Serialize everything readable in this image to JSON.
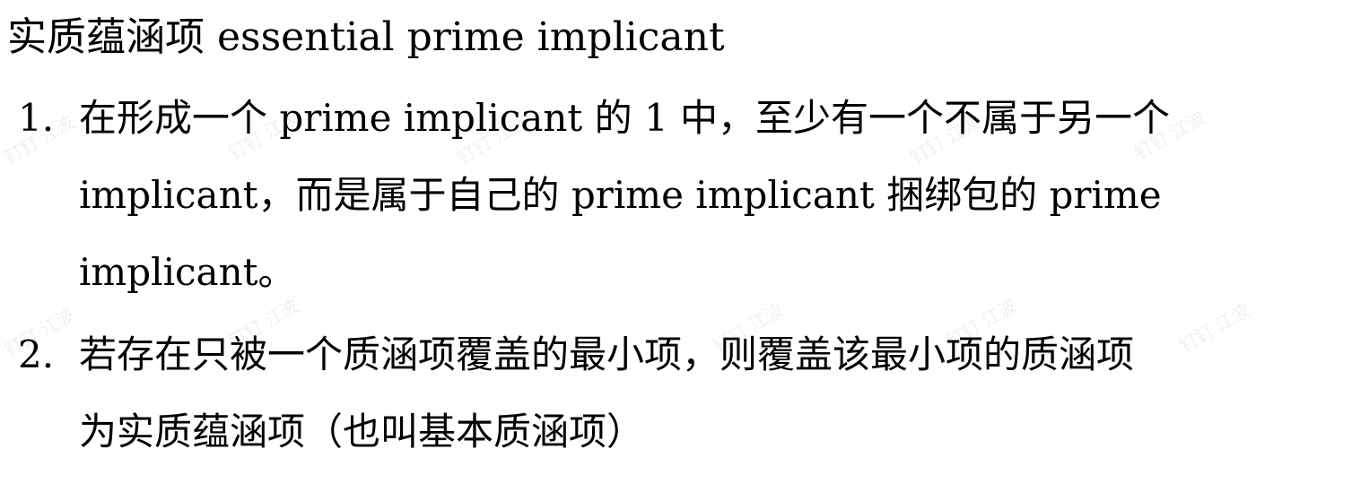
{
  "document": {
    "title": "实质蕴涵项 essential prime implicant",
    "items": [
      {
        "number": "1.",
        "lines": [
          "在形成一个 prime implicant 的 1 中，至少有一个不属于另一个",
          "implicant，而是属于自己的 prime implicant 捆绑包的 prime",
          "implicant。"
        ]
      },
      {
        "number": "2.",
        "lines": [
          "若存在只被一个质涵项覆盖的最小项，则覆盖该最小项的质涵项",
          "为实质蕴涵项（也叫基本质涵项）"
        ]
      }
    ],
    "watermark_text": "钉钉 江波"
  }
}
